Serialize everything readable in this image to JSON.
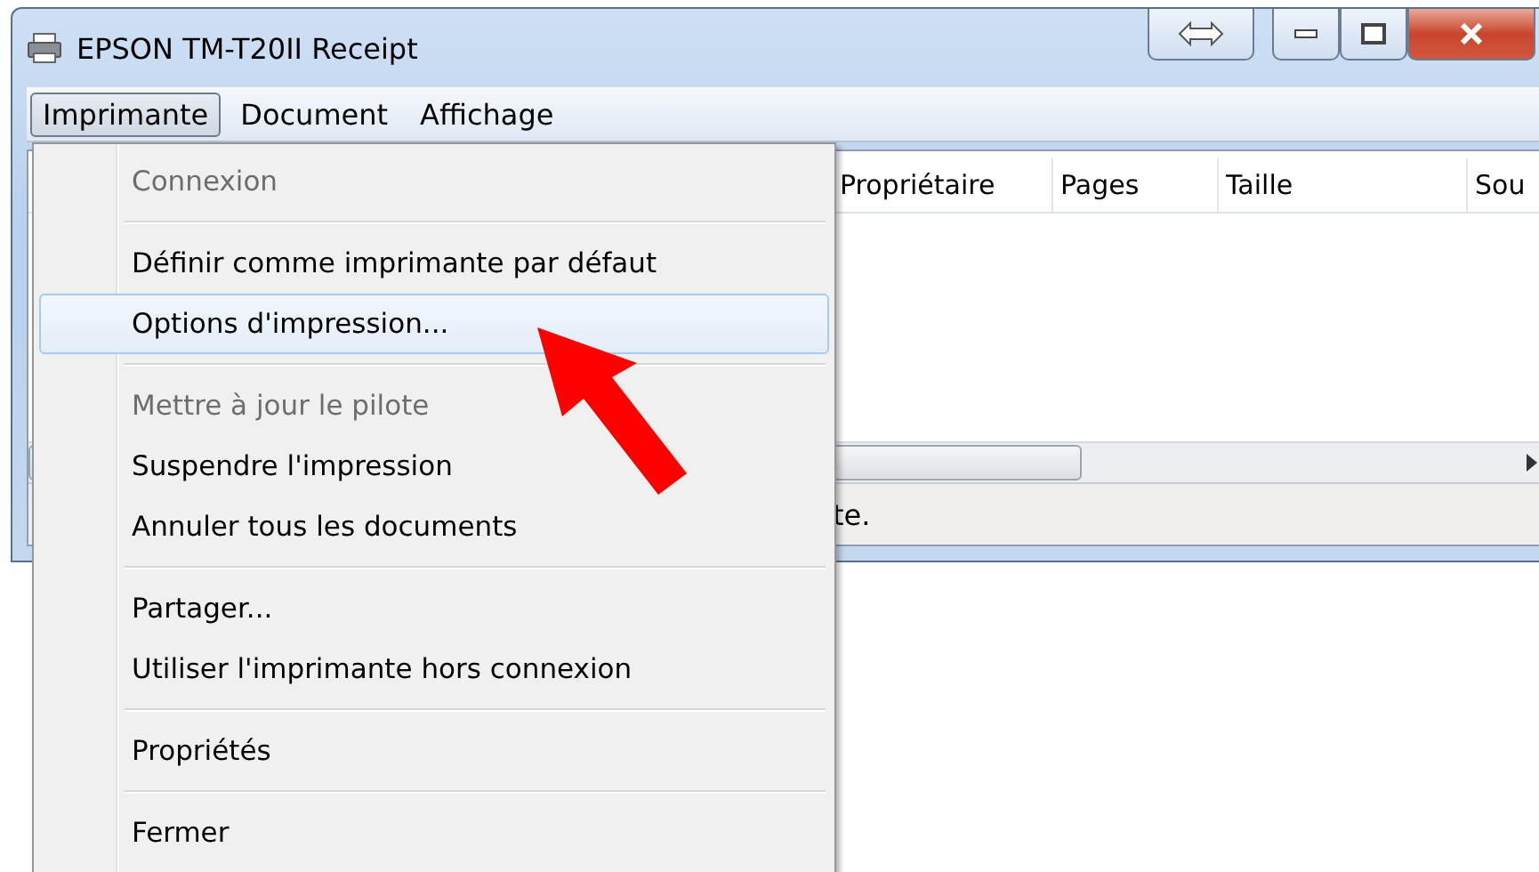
{
  "window": {
    "title": "EPSON TM-T20II Receipt"
  },
  "menu_bar": [
    {
      "label": "Imprimante",
      "selected": true
    },
    {
      "label": "Document",
      "selected": false
    },
    {
      "label": "Affichage",
      "selected": false
    }
  ],
  "table": {
    "columns": [
      "Propriétaire",
      "Pages",
      "Taille",
      "Sou"
    ]
  },
  "status_bar": "te.",
  "menu": [
    {
      "kind": "item",
      "label": "Connexion",
      "disabled": true,
      "selected": false
    },
    {
      "kind": "separator"
    },
    {
      "kind": "item",
      "label": "Définir comme imprimante par défaut",
      "disabled": false,
      "selected": false
    },
    {
      "kind": "item",
      "label": "Options d'impression...",
      "disabled": false,
      "selected": true
    },
    {
      "kind": "separator"
    },
    {
      "kind": "item",
      "label": "Mettre à jour le pilote",
      "disabled": true,
      "selected": false
    },
    {
      "kind": "item",
      "label": "Suspendre l'impression",
      "disabled": false,
      "selected": false
    },
    {
      "kind": "item",
      "label": "Annuler tous les documents",
      "disabled": false,
      "selected": false
    },
    {
      "kind": "separator"
    },
    {
      "kind": "item",
      "label": "Partager...",
      "disabled": false,
      "selected": false
    },
    {
      "kind": "item",
      "label": "Utiliser l'imprimante hors connexion",
      "disabled": false,
      "selected": false
    },
    {
      "kind": "separator"
    },
    {
      "kind": "item",
      "label": "Propriétés",
      "disabled": false,
      "selected": false
    },
    {
      "kind": "separator"
    },
    {
      "kind": "item",
      "label": "Fermer",
      "disabled": false,
      "selected": false
    }
  ]
}
